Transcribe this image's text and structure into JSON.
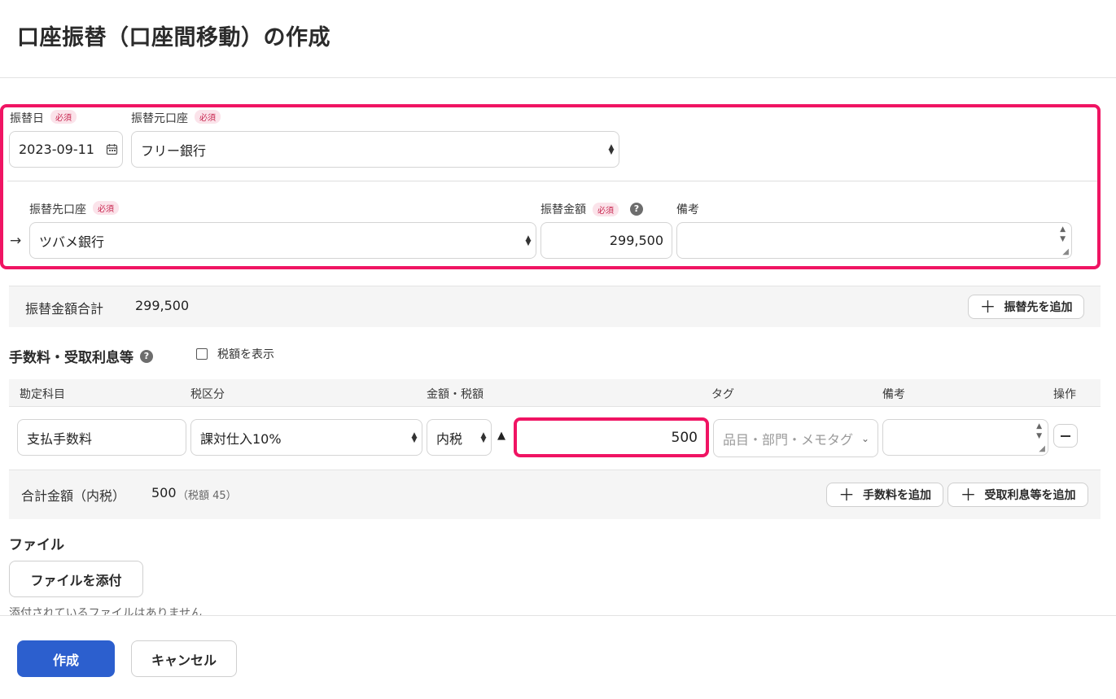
{
  "page_title": "口座振替（口座間移動）の作成",
  "required_badge": "必須",
  "transfer_date": {
    "label": "振替日",
    "value": "2023-09-11"
  },
  "source_account": {
    "label": "振替元口座",
    "value": "フリー銀行"
  },
  "destination": {
    "arrow": "→",
    "account_label": "振替先口座",
    "account_value": "ツバメ銀行",
    "amount_label": "振替金額",
    "amount_value": "299,500",
    "memo_label": "備考",
    "memo_value": ""
  },
  "transfer_summary": {
    "label": "振替金額合計",
    "value": "299,500",
    "add_button": "振替先を追加"
  },
  "fees": {
    "section_title": "手数料・受取利息等",
    "show_tax_label": "税額を表示",
    "columns": [
      "勘定科目",
      "税区分",
      "金額・税額",
      "タグ",
      "備考",
      "操作"
    ],
    "row": {
      "account": "支払手数料",
      "tax_category": "課対仕入10%",
      "tax_mode": "内税",
      "amount": "500",
      "tag_placeholder": "品目・部門・メモタグ",
      "memo": ""
    },
    "total_label": "合計金額（内税）",
    "total_value": "500",
    "total_tax_note": "（税額 45）",
    "add_fee_button": "手数料を追加",
    "add_interest_button": "受取利息等を追加"
  },
  "files": {
    "section_title": "ファイル",
    "attach_button": "ファイルを添付",
    "empty_message": "添付されているファイルはありません"
  },
  "footer": {
    "create_button": "作成",
    "cancel_button": "キャンセル"
  },
  "colors": {
    "highlight": "#f01463",
    "primary": "#2c5fce",
    "required_text": "#c7254e",
    "required_bg": "#fbe3ea"
  }
}
